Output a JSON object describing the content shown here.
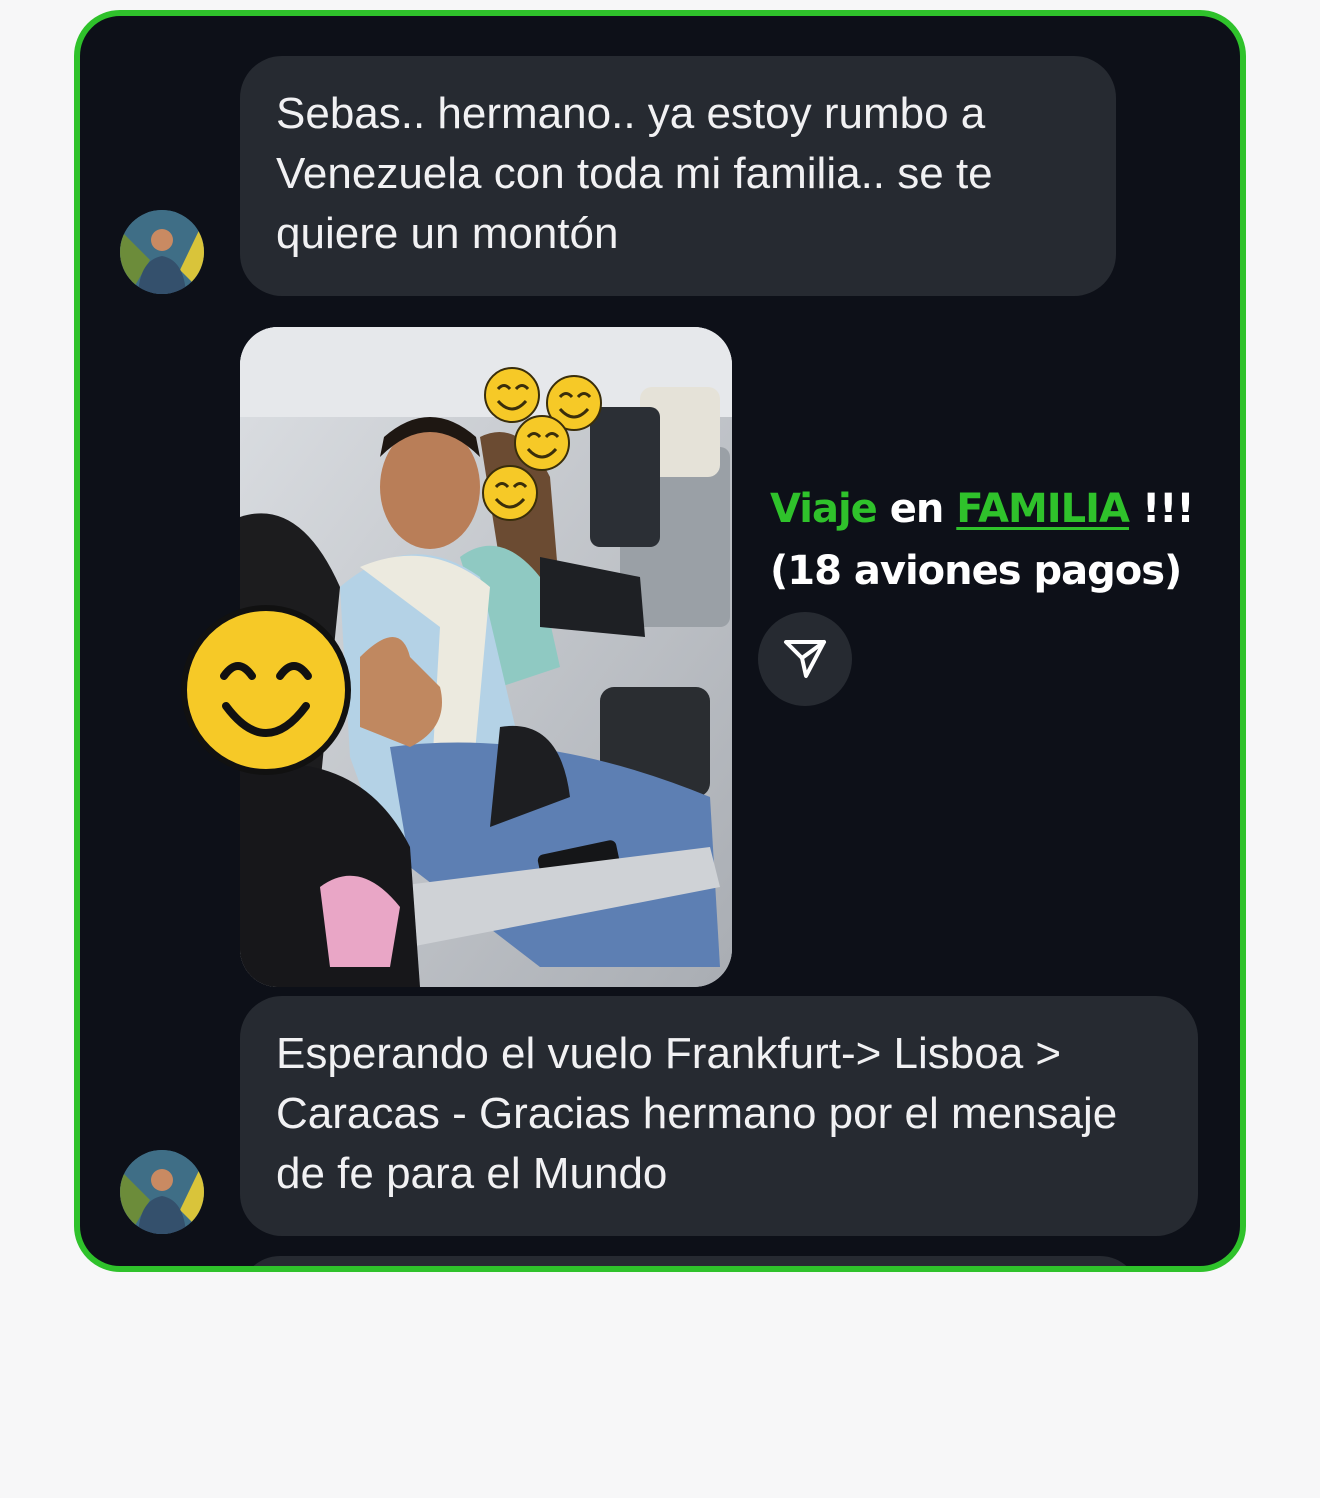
{
  "conversation": {
    "message_1": {
      "text_before": "Sebas.. hermano.. ya estoy rumbo a ",
      "text_underlined": "Venezuela con toda mi familia",
      "text_after": ".. se te quiere un montón"
    },
    "photo_caption": {
      "word_1": "Viaje",
      "word_2": "en",
      "word_3": "FAMILIA",
      "word_4": "!!!",
      "line_2": "(18 aviones pagos)"
    },
    "message_2": {
      "text_before": "Esperando el vuelo Frankfurt-> Lisboa > Caracas - ",
      "text_underlined": "Gracias hermano",
      "text_after": " por el mensaje de fe para el Mundo"
    }
  },
  "icons": {
    "share": "paper-plane-icon",
    "avatar": "user-avatar",
    "emoji": "smiling-face-emoji"
  },
  "colors": {
    "frame_border": "#2fc22b",
    "background": "#0d1018",
    "bubble": "#262a31",
    "highlight_underline": "#e0141b",
    "accent_green": "#2fc22b"
  }
}
